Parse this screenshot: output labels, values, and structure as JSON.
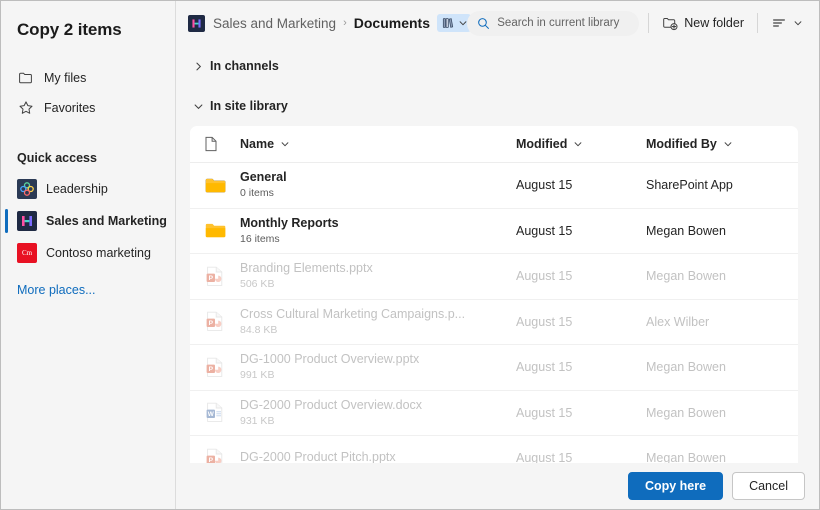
{
  "dialog": {
    "title": "Copy 2 items"
  },
  "sidebar": {
    "nav": [
      {
        "label": "My files",
        "icon": "folder-outline-icon"
      },
      {
        "label": "Favorites",
        "icon": "star-outline-icon"
      }
    ],
    "quick_access_heading": "Quick access",
    "quick_access": [
      {
        "label": "Leadership",
        "icon": "leadership-site-icon",
        "selected": false
      },
      {
        "label": "Sales and Marketing",
        "icon": "sales-marketing-site-icon",
        "selected": true
      },
      {
        "label": "Contoso marketing",
        "icon": "contoso-marketing-site-icon",
        "selected": false
      }
    ],
    "more_places": "More places..."
  },
  "topbar": {
    "breadcrumb": {
      "site": "Sales and Marketing",
      "separator": "›",
      "current": "Documents"
    },
    "library_chip": {
      "icon": "library-books-icon",
      "chevron": "chevron-down-icon"
    },
    "search": {
      "placeholder": "Search in current library",
      "value": "",
      "icon": "search-icon"
    },
    "new_folder": {
      "label": "New folder",
      "icon": "new-folder-icon"
    },
    "view_options": {
      "icon": "sort-list-icon",
      "chevron": "chevron-down-icon"
    }
  },
  "groups": {
    "channels": {
      "label": "In channels",
      "expanded": false
    },
    "site_library": {
      "label": "In site library",
      "expanded": true
    }
  },
  "table": {
    "columns": {
      "icon": "file-type-icon",
      "name": "Name",
      "modified": "Modified",
      "modified_by": "Modified By"
    },
    "rows": [
      {
        "name": "General",
        "sub": "0 items",
        "modified": "August 15",
        "modified_by": "SharePoint App",
        "icon": "folder-icon",
        "enabled": true
      },
      {
        "name": "Monthly Reports",
        "sub": "16 items",
        "modified": "August 15",
        "modified_by": "Megan Bowen",
        "icon": "folder-icon",
        "enabled": true
      },
      {
        "name": "Branding Elements.pptx",
        "sub": "506 KB",
        "modified": "August 15",
        "modified_by": "Megan Bowen",
        "icon": "powerpoint-icon",
        "enabled": false
      },
      {
        "name": "Cross Cultural Marketing Campaigns.p...",
        "sub": "84.8 KB",
        "modified": "August 15",
        "modified_by": "Alex Wilber",
        "icon": "powerpoint-icon",
        "enabled": false
      },
      {
        "name": "DG-1000 Product Overview.pptx",
        "sub": "991 KB",
        "modified": "August 15",
        "modified_by": "Megan Bowen",
        "icon": "powerpoint-icon",
        "enabled": false
      },
      {
        "name": "DG-2000 Product Overview.docx",
        "sub": "931 KB",
        "modified": "August 15",
        "modified_by": "Megan Bowen",
        "icon": "word-icon",
        "enabled": false
      },
      {
        "name": "DG-2000 Product Pitch.pptx",
        "sub": "",
        "modified": "August 15",
        "modified_by": "Megan Bowen",
        "icon": "powerpoint-icon",
        "enabled": false
      }
    ]
  },
  "footer": {
    "primary": "Copy here",
    "secondary": "Cancel"
  },
  "colors": {
    "accent": "#0f6cbd",
    "link": "#0f6cbd",
    "folder": "#ffc107",
    "powerpoint": "#d24726",
    "word": "#2b579a",
    "chip_bg": "#cfe4fa",
    "panel_bg": "#f5f5f5",
    "card_bg": "#ffffff"
  }
}
